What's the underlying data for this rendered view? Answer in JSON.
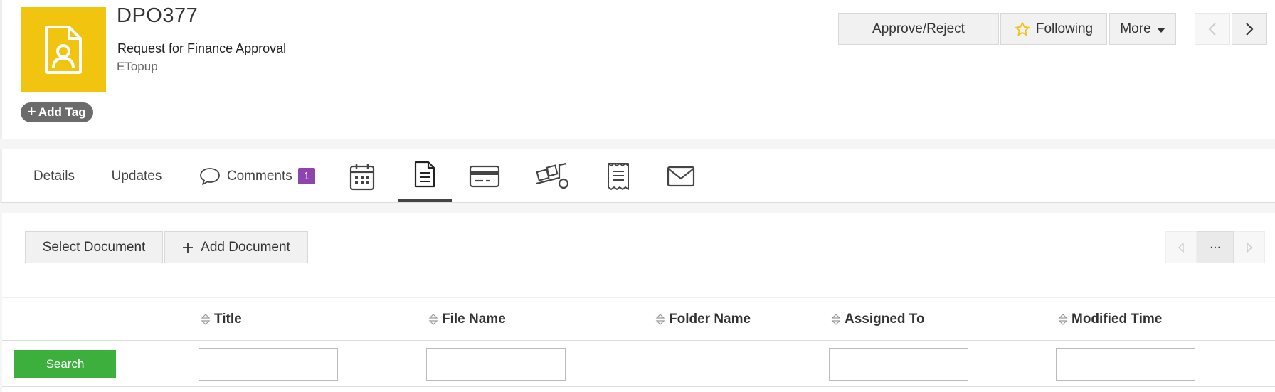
{
  "record": {
    "id": "DPO377",
    "subtitle": "Request for Finance Approval",
    "org": "ETopup",
    "add_tag_label": "Add Tag",
    "logo_icon": "document-user-icon",
    "logo_color": "#f1c40f"
  },
  "actions": {
    "approve_label": "Approve/Reject",
    "following_label": "Following",
    "more_label": "More"
  },
  "tabs": {
    "details": "Details",
    "updates": "Updates",
    "comments": "Comments",
    "comments_count": "1",
    "icon_tabs": [
      "calendar-icon",
      "document-icon",
      "credit-card-icon",
      "delivery-icon",
      "receipt-icon",
      "mail-icon"
    ],
    "active": "document-icon"
  },
  "documents": {
    "select_label": "Select Document",
    "add_label": "Add Document",
    "pager_dots": "···",
    "columns": [
      "Title",
      "File Name",
      "Folder Name",
      "Assigned To",
      "Modified Time"
    ],
    "search_label": "Search"
  },
  "colors": {
    "badge": "#8e44ad",
    "search_button": "#3daf3d",
    "star": "#f1c40f"
  }
}
